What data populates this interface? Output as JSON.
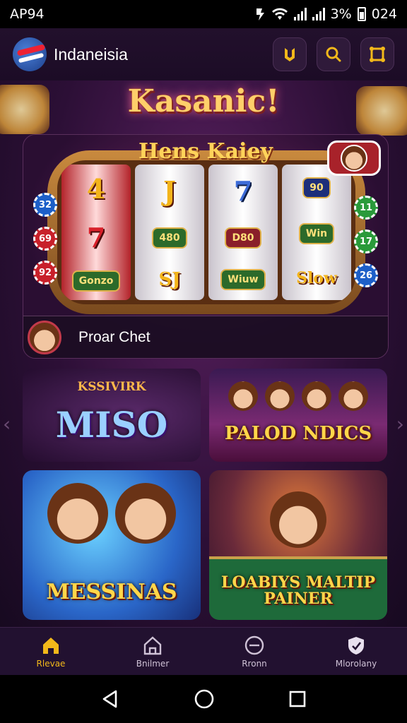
{
  "status_bar": {
    "left_text": "AP94",
    "battery": "3%",
    "time": "024"
  },
  "header": {
    "title": "Indaneisia",
    "icons": [
      "coins-icon",
      "search-icon",
      "settings-icon"
    ]
  },
  "brand": {
    "title": "Kasanic!"
  },
  "featured": {
    "title": "Hens Kaiey",
    "label": "Proar Chet",
    "reels": [
      {
        "symbols": [
          "4",
          "7",
          "Gonzo"
        ]
      },
      {
        "symbols": [
          "J",
          "480",
          "SJ"
        ]
      },
      {
        "symbols": [
          "7",
          "D80",
          "Wiuw"
        ]
      },
      {
        "symbols": [
          "90",
          "Win",
          "Slow"
        ]
      }
    ],
    "left_chips": [
      "32",
      "69",
      "92"
    ],
    "right_chips": [
      "11",
      "17",
      "26"
    ]
  },
  "tiles": [
    {
      "kicker": "KSSIVIRK",
      "title": "MISO"
    },
    {
      "title": "PALOD NDICS"
    },
    {
      "title": "MESSINAS"
    },
    {
      "title": "LOABIYS MALTIP PAINER"
    }
  ],
  "bottom_nav": [
    {
      "label": "Rlevae",
      "icon": "home-icon",
      "active": true
    },
    {
      "label": "Bnilmer",
      "icon": "house-outline-icon",
      "active": false
    },
    {
      "label": "Rronn",
      "icon": "tv-icon",
      "active": false
    },
    {
      "label": "Mlorolany",
      "icon": "shield-icon",
      "active": false
    }
  ],
  "colors": {
    "accent": "#f2b81a",
    "background": "#1a0c24",
    "nav": "#221130"
  }
}
